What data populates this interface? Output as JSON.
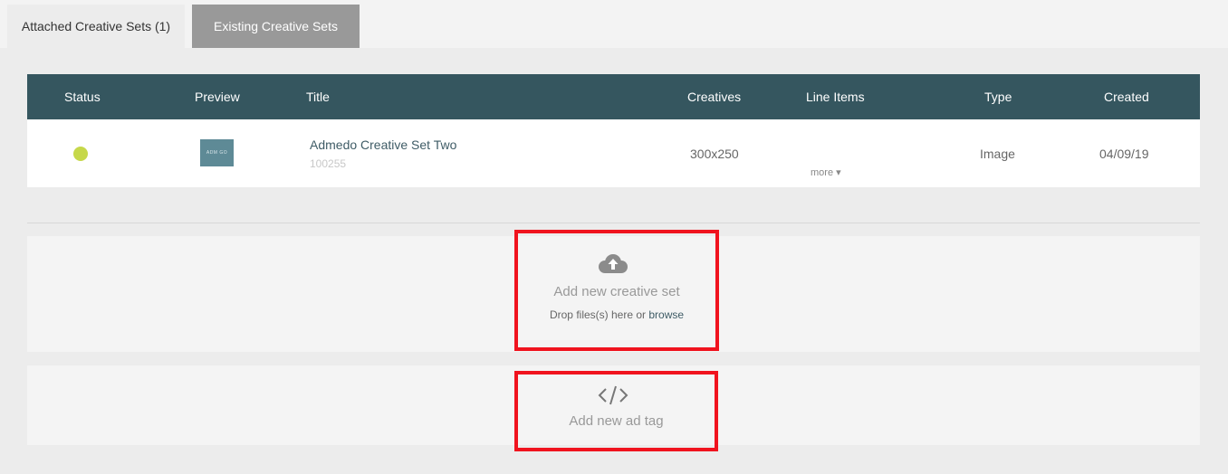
{
  "tabs": [
    {
      "label": "Attached Creative Sets (1)",
      "active": true
    },
    {
      "label": "Existing Creative Sets",
      "active": false
    }
  ],
  "table": {
    "columns": [
      "Status",
      "Preview",
      "Title",
      "Creatives",
      "Line Items",
      "Type",
      "Created"
    ],
    "rows": [
      {
        "status": "active",
        "status_color": "#c6d84a",
        "preview_text": "ADM GO",
        "title": "Admedo Creative Set Two",
        "id": "100255",
        "creatives": "300x250",
        "line_items_more": "more ▾",
        "type": "Image",
        "created": "04/09/19"
      }
    ]
  },
  "upload": {
    "icon": "cloud-upload-icon",
    "title": "Add new creative set",
    "drop_text": "Drop files(s) here or ",
    "browse_label": "browse"
  },
  "ad_tag": {
    "icon": "code-icon",
    "title": "Add new ad tag"
  },
  "colors": {
    "header_bg": "#35565f",
    "highlight": "#f0131e",
    "link": "#3f5c66"
  }
}
